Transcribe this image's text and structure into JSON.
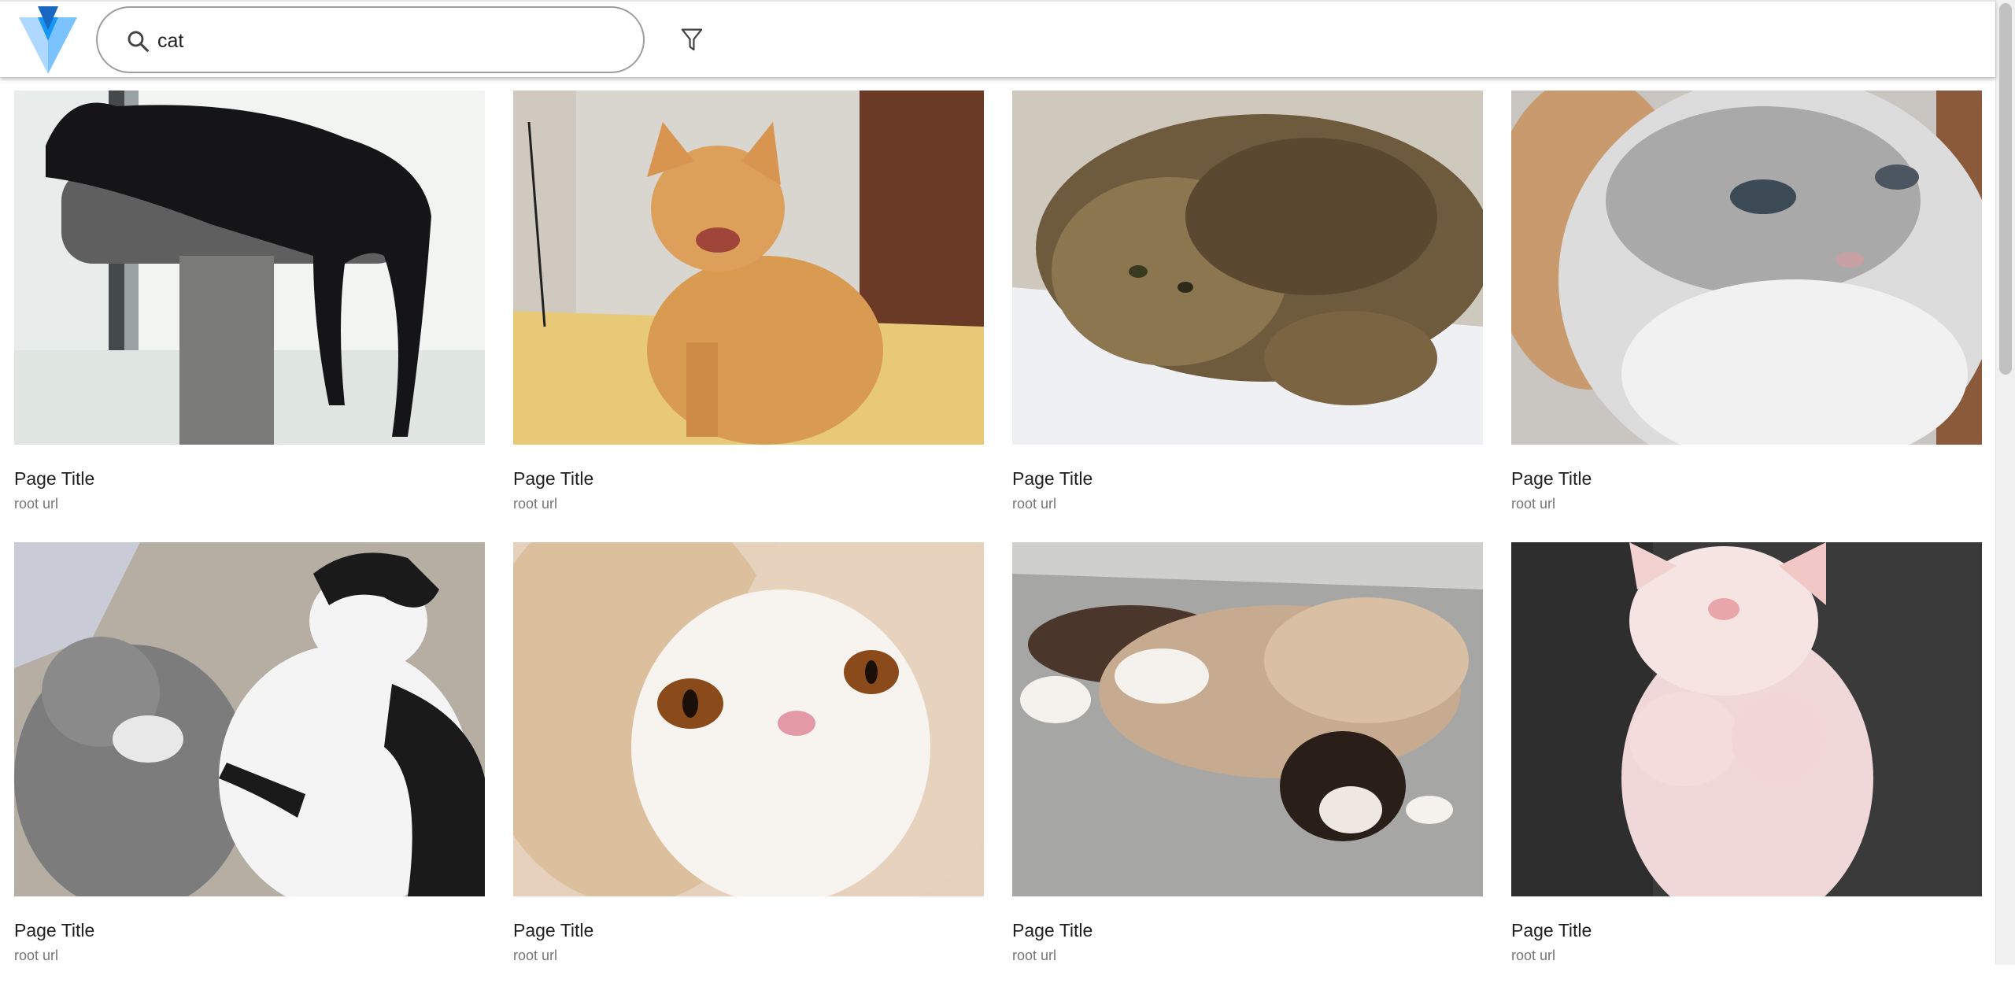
{
  "search": {
    "value": "cat",
    "placeholder": ""
  },
  "icons": {
    "logo": "vuetify-logo",
    "search": "search-icon",
    "filter": "filter-icon"
  },
  "colors": {
    "logo_light": "#7bc3ff",
    "logo_mid": "#1697f6",
    "logo_dark": "#1867c0",
    "url_text": "#757575"
  },
  "results": [
    {
      "title": "Page Title",
      "url": "root url",
      "image": "black cat lying on a cat tree perch"
    },
    {
      "title": "Page Title",
      "url": "root url",
      "image": "orange tabby cat sitting on a floor"
    },
    {
      "title": "Page Title",
      "url": "root url",
      "image": "fluffy brown persian cat on white cushion"
    },
    {
      "title": "Page Title",
      "url": "root url",
      "image": "grey and white fluffy cat face close-up"
    },
    {
      "title": "Page Title",
      "url": "root url",
      "image": "grey cat and black-and-white cat lying on carpet"
    },
    {
      "title": "Page Title",
      "url": "root url",
      "image": "cream persian cat face with copper eyes"
    },
    {
      "title": "Page Title",
      "url": "root url",
      "image": "siamese-mix cat lying on concrete"
    },
    {
      "title": "Page Title",
      "url": "root url",
      "image": "white kitten sleeping on its back"
    }
  ]
}
